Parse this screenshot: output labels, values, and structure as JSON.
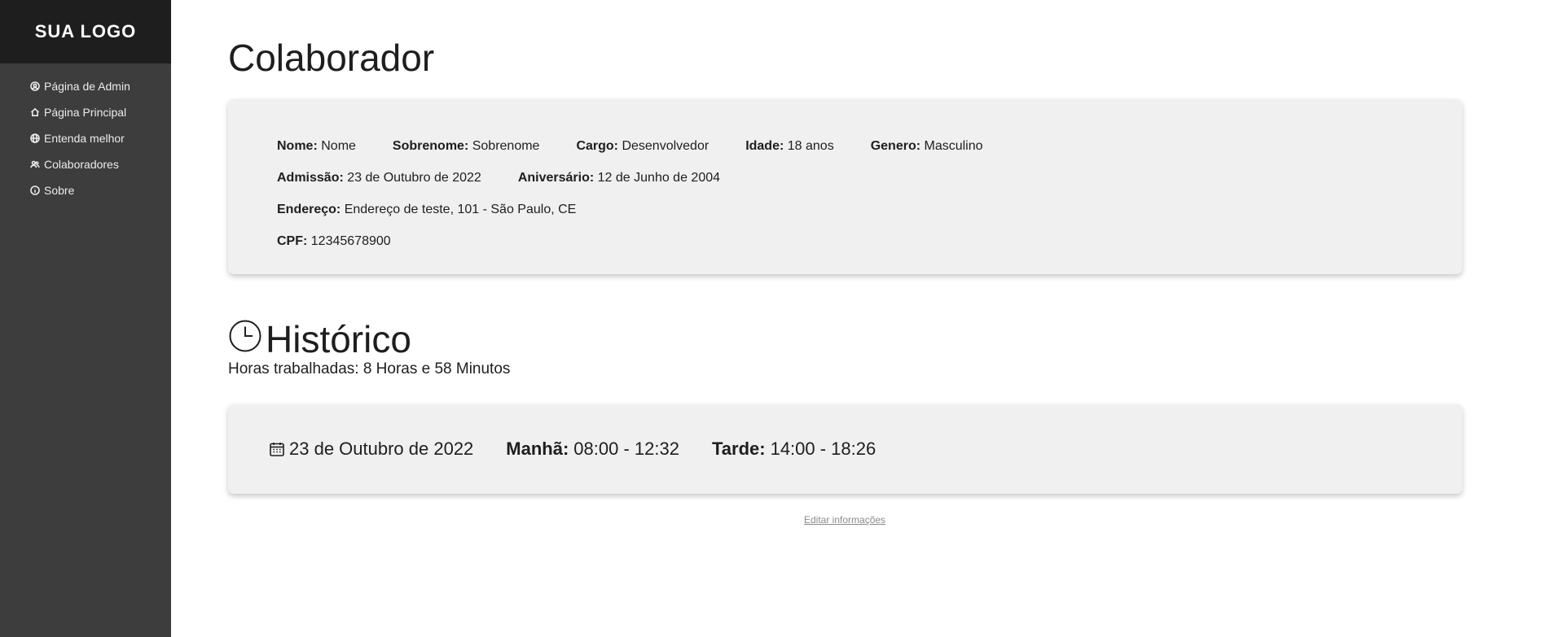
{
  "sidebar": {
    "logo": "SUA LOGO",
    "items": [
      {
        "label": "Página de Admin",
        "icon": "user-circle-icon"
      },
      {
        "label": "Página Principal",
        "icon": "home-icon"
      },
      {
        "label": "Entenda melhor",
        "icon": "globe-icon"
      },
      {
        "label": "Colaboradores",
        "icon": "users-icon"
      },
      {
        "label": "Sobre",
        "icon": "info-icon"
      }
    ]
  },
  "main": {
    "title": "Colaborador",
    "info": {
      "nome_label": "Nome:",
      "nome": "Nome",
      "sobrenome_label": "Sobrenome:",
      "sobrenome": "Sobrenome",
      "cargo_label": "Cargo:",
      "cargo": "Desenvolvedor",
      "idade_label": "Idade:",
      "idade": "18 anos",
      "genero_label": "Genero:",
      "genero": "Masculino",
      "admissao_label": "Admissão:",
      "admissao": "23 de Outubro de 2022",
      "aniversario_label": "Aniversário:",
      "aniversario": "12 de Junho de 2004",
      "endereco_label": "Endereço:",
      "endereco": "Endereço de teste, 101 - São Paulo, CE",
      "cpf_label": "CPF:",
      "cpf": "12345678900"
    },
    "history": {
      "title": "Histórico",
      "hours_text": "Horas trabalhadas: 8 Horas e 58 Minutos",
      "entries": [
        {
          "date": "23 de Outubro de 2022",
          "morning_label": "Manhã:",
          "morning": "08:00 - 12:32",
          "afternoon_label": "Tarde:",
          "afternoon": "14:00 - 18:26"
        }
      ]
    },
    "edit_link": "Editar informações"
  }
}
